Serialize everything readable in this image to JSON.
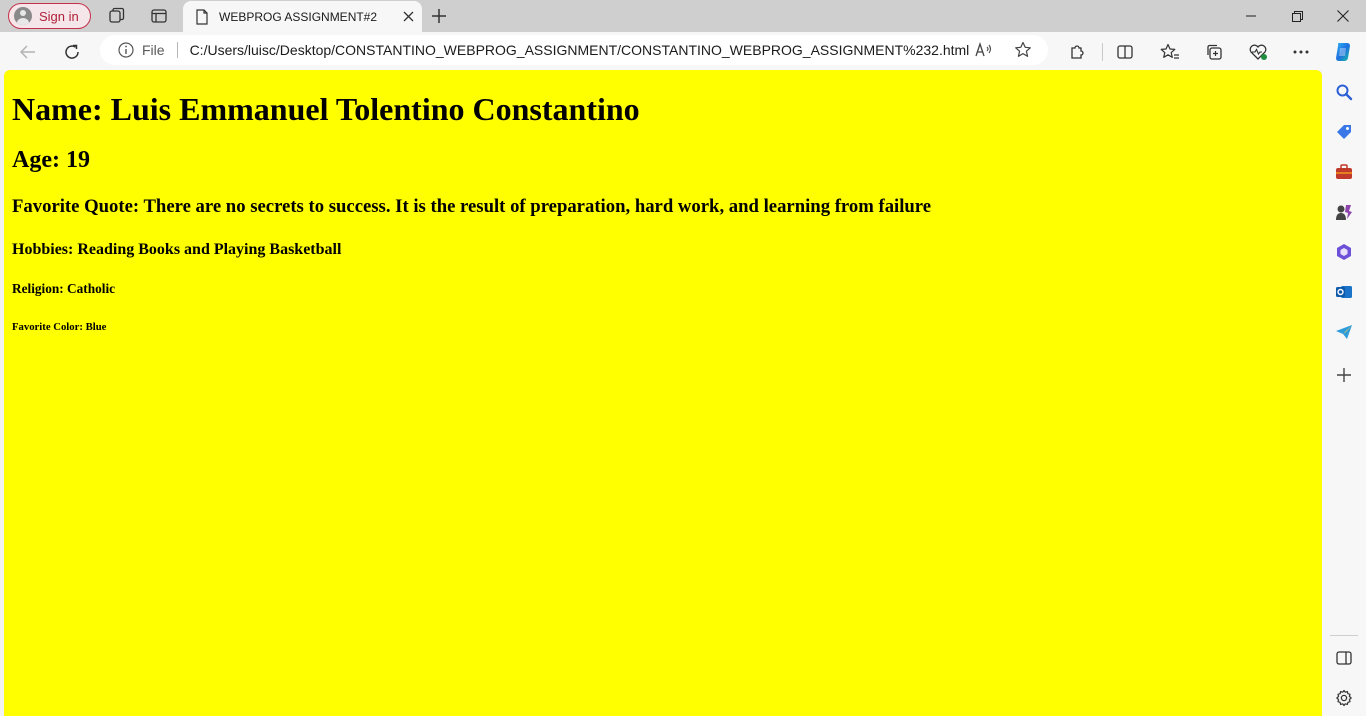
{
  "browser": {
    "signin_label": "Sign in",
    "tab_title": "WEBPROG ASSIGNMENT#2",
    "address": {
      "scheme": "File",
      "url": "C:/Users/luisc/Desktop/CONSTANTINO_WEBPROG_ASSIGNMENT/CONSTANTINO_WEBPROG_ASSIGNMENT%232.html"
    }
  },
  "page": {
    "background": "#ffff00",
    "name": "Name: Luis Emmanuel Tolentino Constantino",
    "age": "Age: 19",
    "quote": "Favorite Quote: There are no secrets to success. It is the result of preparation, hard work, and learning from failure",
    "hobbies": "Hobbies: Reading Books and Playing Basketball",
    "religion": "Religion: Catholic",
    "color": "Favorite Color: Blue"
  },
  "icons": {
    "tabstrip": [
      "profile-icon",
      "workspaces-icon",
      "tab-actions-icon",
      "page-icon",
      "close-icon",
      "plus-icon",
      "minimize-icon",
      "restore-icon",
      "close-window-icon"
    ],
    "toolbar": [
      "back-icon",
      "refresh-icon",
      "info-icon",
      "read-aloud-icon",
      "star-icon",
      "extensions-icon",
      "split-screen-icon",
      "favorites-icon",
      "collections-icon",
      "browser-essentials-icon",
      "more-icon",
      "copilot-icon"
    ],
    "sidebar": [
      "search-icon",
      "shopping-icon",
      "tools-icon",
      "games-icon",
      "office-icon",
      "outlook-icon",
      "drop-icon",
      "add-icon",
      "hide-sidebar-icon",
      "settings-icon"
    ]
  }
}
